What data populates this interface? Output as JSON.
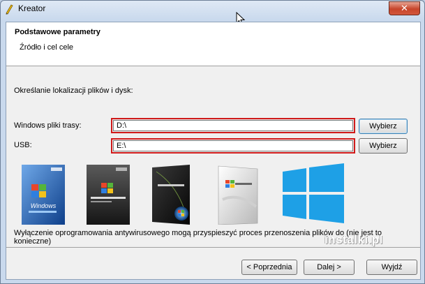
{
  "window": {
    "title": "Kreator",
    "close_label": "✕"
  },
  "header": {
    "title": "Podstawowe parametry",
    "subtitle": "Źródło i cel cele"
  },
  "content": {
    "section_label": "Określanie lokalizacji plików i dysk:",
    "rows": [
      {
        "label": "Windows pliki trasy:",
        "value": "D:\\",
        "button": "Wybierz"
      },
      {
        "label": "USB:",
        "value": "E:\\",
        "button": "Wybierz"
      }
    ],
    "os_boxes": [
      {
        "name": "windows-xp-box",
        "product": "Windows XP",
        "brand": "Microsoft"
      },
      {
        "name": "windows-server-2003-box",
        "product": "Windows Server 2003",
        "brand": "Microsoft"
      },
      {
        "name": "windows-vista-box",
        "product": "Windows Vista",
        "brand": ""
      },
      {
        "name": "windows-server-2008-box",
        "product": "Windows Server 2008",
        "brand": ""
      },
      {
        "name": "windows-8-logo",
        "product": "",
        "brand": ""
      }
    ],
    "note": "Wyłączenie oprogramowania antywirusowego mogą przyspieszyć proces przenoszenia plików do (nie jest to konieczne)"
  },
  "footer": {
    "back": "< Poprzednia",
    "next": "Dalej >",
    "exit": "Wyjdź"
  },
  "watermark": {
    "text": "instalki.pl"
  },
  "colors": {
    "highlight": "#d01a1a",
    "title_gradient_top": "#dfe9f5",
    "win8_blue": "#1ea0e6"
  }
}
